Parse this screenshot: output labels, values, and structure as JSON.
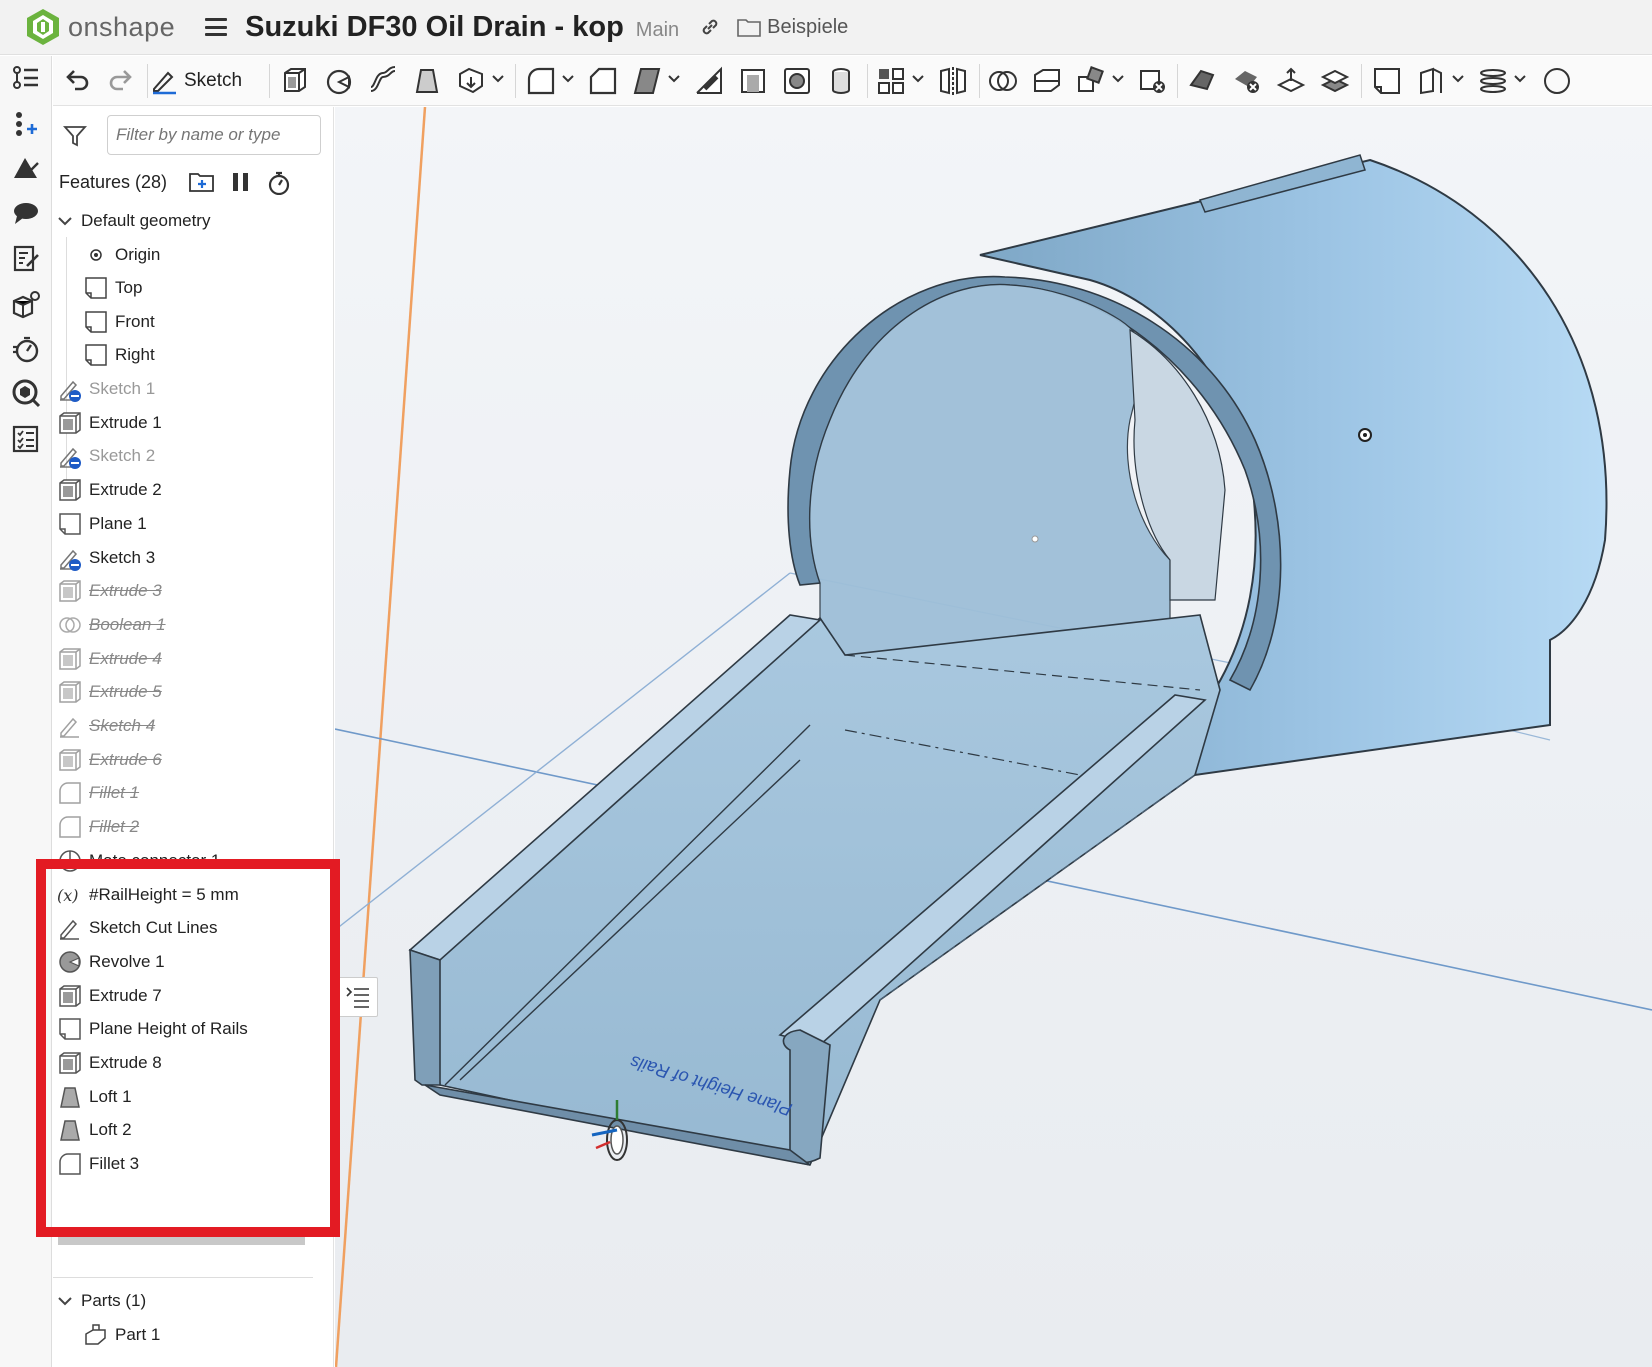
{
  "app": {
    "name": "onshape"
  },
  "document": {
    "title": "Suzuki DF30 Oil Drain - kop",
    "branch": "Main",
    "folder": "Beispiele"
  },
  "toolbar": {
    "sketch_label": "Sketch"
  },
  "filter": {
    "placeholder": "Filter by name or type"
  },
  "features": {
    "title": "Features (28)",
    "default_geometry": {
      "label": "Default geometry",
      "items": [
        "Origin",
        "Top",
        "Front",
        "Right"
      ]
    },
    "items": [
      {
        "label": "Sketch 1",
        "state": "hidden",
        "icon": "sketch-hidden-icon"
      },
      {
        "label": "Extrude 1",
        "state": "active",
        "icon": "extrude-icon"
      },
      {
        "label": "Sketch 2",
        "state": "hidden",
        "icon": "sketch-hidden-icon"
      },
      {
        "label": "Extrude 2",
        "state": "active",
        "icon": "extrude-icon"
      },
      {
        "label": "Plane 1",
        "state": "active",
        "icon": "plane-icon"
      },
      {
        "label": "Sketch 3",
        "state": "active",
        "icon": "sketch-hidden-icon"
      },
      {
        "label": "Extrude 3",
        "state": "suppressed",
        "icon": "extrude-icon"
      },
      {
        "label": "Boolean 1",
        "state": "suppressed",
        "icon": "boolean-icon"
      },
      {
        "label": "Extrude 4",
        "state": "suppressed",
        "icon": "extrude-icon"
      },
      {
        "label": "Extrude 5",
        "state": "suppressed",
        "icon": "extrude-icon"
      },
      {
        "label": "Sketch 4",
        "state": "suppressed",
        "icon": "sketch-icon"
      },
      {
        "label": "Extrude 6",
        "state": "suppressed",
        "icon": "extrude-icon"
      },
      {
        "label": "Fillet 1",
        "state": "suppressed",
        "icon": "fillet-icon"
      },
      {
        "label": "Fillet 2",
        "state": "suppressed",
        "icon": "fillet-icon"
      },
      {
        "label": "Mate connector 1",
        "state": "active",
        "icon": "mate-connector-icon"
      },
      {
        "label": "#RailHeight = 5 mm",
        "state": "active",
        "icon": "variable-icon"
      },
      {
        "label": "Sketch Cut Lines",
        "state": "active",
        "icon": "sketch-icon"
      },
      {
        "label": "Revolve 1",
        "state": "active",
        "icon": "revolve-icon"
      },
      {
        "label": "Extrude 7",
        "state": "active",
        "icon": "extrude-icon"
      },
      {
        "label": "Plane Height of Rails",
        "state": "active",
        "icon": "plane-icon"
      },
      {
        "label": "Extrude 8",
        "state": "active",
        "icon": "extrude-icon"
      },
      {
        "label": "Loft 1",
        "state": "active",
        "icon": "loft-icon"
      },
      {
        "label": "Loft 2",
        "state": "active",
        "icon": "loft-icon"
      },
      {
        "label": "Fillet 3",
        "state": "active",
        "icon": "fillet-icon"
      }
    ]
  },
  "parts": {
    "title": "Parts (1)",
    "items": [
      "Part 1"
    ]
  },
  "viewport": {
    "plane_label": "Plane Height of Rails",
    "model_color": "#9cc4e4",
    "edge_color": "#2f3a44",
    "highlight_color": "#e31b23",
    "mate_axes": {
      "x_color": "#d32f2f",
      "y_color": "#2e7d32",
      "z_color": "#1565c0"
    }
  }
}
